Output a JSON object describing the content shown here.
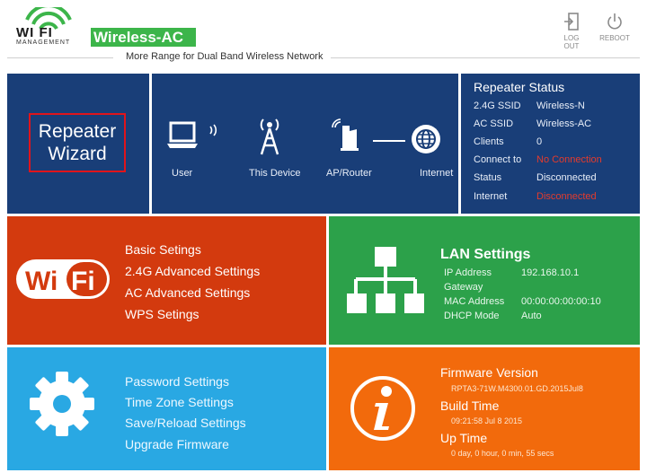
{
  "header": {
    "logo_wifi_text": "WI FI",
    "logo_mgmt_text": "MANAGEMENT",
    "brand": "Wireless-AC",
    "tagline": "More Range for Dual Band Wireless Network",
    "logout_label": "LOG OUT",
    "reboot_label": "REBOOT"
  },
  "wizard": {
    "line1": "Repeater",
    "line2": "Wizard"
  },
  "topology": {
    "labels": [
      "User",
      "This Device",
      "AP/Router",
      "Internet"
    ]
  },
  "status": {
    "title": "Repeater Status",
    "rows": [
      {
        "key": "2.4G SSID",
        "value": "Wireless-N"
      },
      {
        "key": "AC SSID",
        "value": "Wireless-AC"
      },
      {
        "key": "Clients",
        "value": "0"
      },
      {
        "key": "Connect to",
        "value": "No Connection"
      },
      {
        "key": "Status",
        "value": "Disconnected"
      },
      {
        "key": "Internet",
        "value": "Disconnected"
      }
    ]
  },
  "basic_menu": {
    "badge_left": "Wi",
    "badge_right": "Fi",
    "items": [
      "Basic Setings",
      "2.4G Advanced Settings",
      "AC Advanced Settings",
      "WPS Setings"
    ]
  },
  "lan": {
    "title": "LAN Settings",
    "rows": [
      {
        "key": "IP Address",
        "value": "192.168.10.1"
      },
      {
        "key": "Gateway",
        "value": ""
      },
      {
        "key": "MAC Address",
        "value": "00:00:00:00:00:10"
      },
      {
        "key": "DHCP Mode",
        "value": "Auto"
      }
    ]
  },
  "system_menu": {
    "items": [
      "Password Settings",
      "Time Zone Settings",
      "Save/Reload Settings",
      "Upgrade Firmware"
    ]
  },
  "firmware": {
    "version_label": "Firmware Version",
    "version_value": "RPTA3-71W.M4300.01.GD.2015Jul8",
    "build_label": "Build Time",
    "build_value": "09:21:58 Jul 8 2015",
    "uptime_label": "Up Time",
    "uptime_value": "0 day, 0 hour, 0 min, 55 secs"
  },
  "colors": {
    "navy": "#193e78",
    "red": "#d33a0e",
    "green": "#2ca14a",
    "blue": "#29a8e3",
    "orange": "#f26a0c",
    "alert": "#e53b2c",
    "brand_green": "#3cb54a"
  }
}
